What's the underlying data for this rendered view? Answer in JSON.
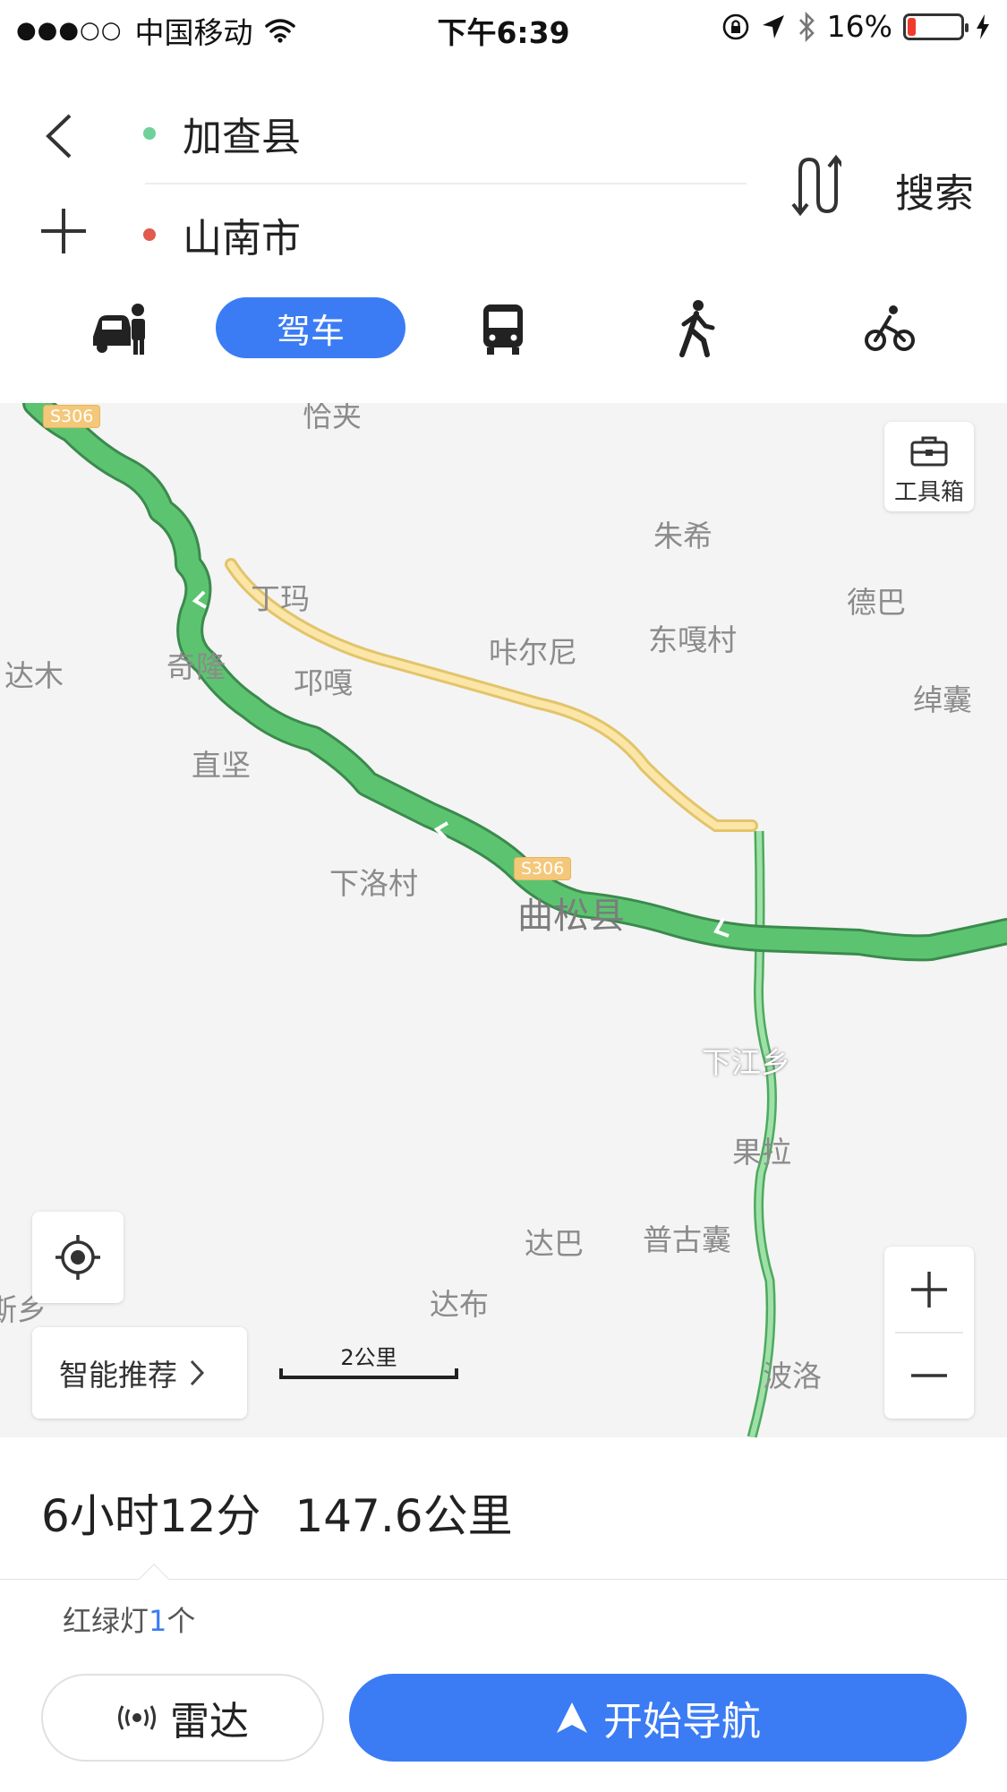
{
  "status_bar": {
    "signal_dots": "●●●○○",
    "carrier": "中国移动",
    "time": "下午6:39",
    "battery": "16%",
    "battery_level": 0.16
  },
  "route": {
    "start": "加查县",
    "end": "山南市",
    "search_label": "搜索",
    "start_dot_color": "#6fd19a",
    "end_dot_color": "#e05a50"
  },
  "modes": {
    "active_label": "驾车",
    "items": [
      "taxi-icon",
      "car-mode",
      "bus-icon",
      "walk-icon",
      "bike-icon"
    ]
  },
  "map": {
    "toolbox_label": "工具箱",
    "smart_label": "智能推荐",
    "scale_label": "2公里",
    "road_code": "S306",
    "places": {
      "p1": "恰夹",
      "p2": "朱希",
      "p3": "丁玛",
      "p4": "德巴",
      "p5": "达木",
      "p6": "奇隆",
      "p7": "咔尔尼",
      "p8": "东嘎村",
      "p9": "邛嘎",
      "p10": "绰囊",
      "p11": "直坚",
      "p12": "下洛村",
      "p13": "曲松县",
      "p14": "下江乡",
      "p15": "果拉",
      "p16": "达巴",
      "p17": "普古囊",
      "p18": "斯乡",
      "p19": "达布",
      "p20": "波洛"
    },
    "colors": {
      "route_main": "#5cc470",
      "route_alt": "#fbe6a8",
      "route_branch": "#9fe0a8"
    }
  },
  "summary": {
    "duration": "6小时12分",
    "distance": "147.6公里",
    "lights_prefix": "红绿灯",
    "lights_count": "1",
    "lights_suffix": "个"
  },
  "actions": {
    "radar_label": "雷达",
    "navigate_label": "开始导航"
  }
}
